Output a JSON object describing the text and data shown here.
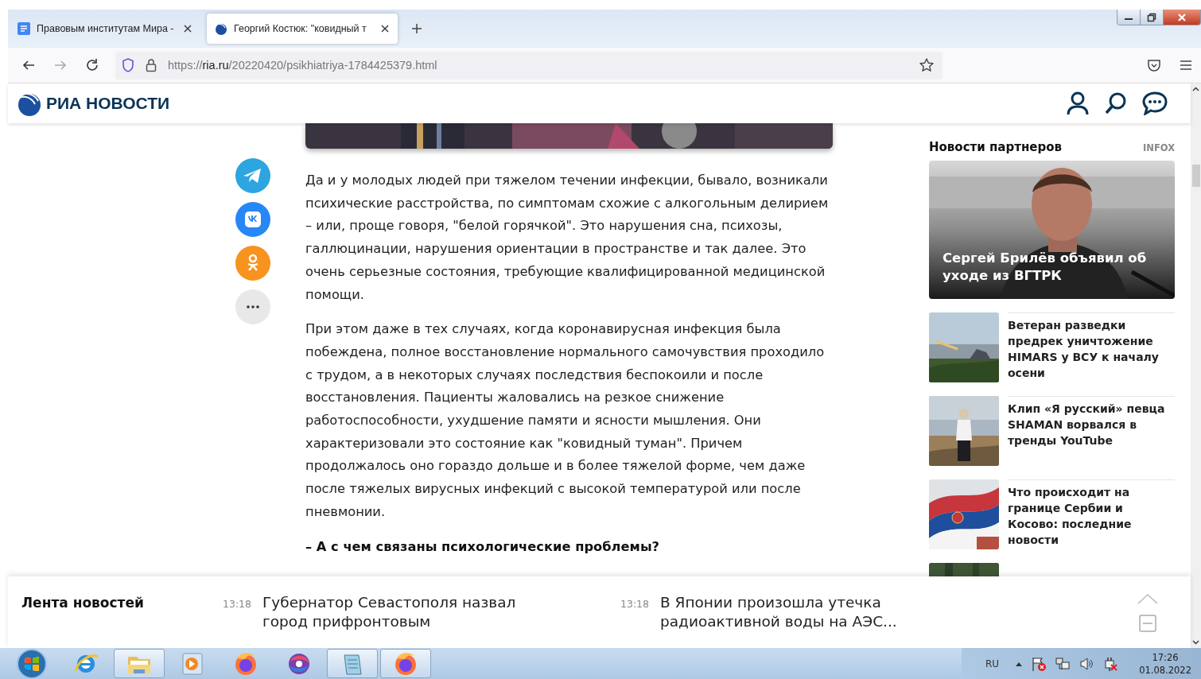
{
  "browser": {
    "tabs": [
      {
        "title": "Правовым институтам Мира -",
        "kind": "document",
        "selected": false
      },
      {
        "title": "Георгий Костюк: \"ковидный т",
        "kind": "ria",
        "selected": true
      }
    ],
    "url": {
      "scheme": "https://",
      "host": "ria.ru",
      "path": "/20220420/psikhiatriya-1784425379.html"
    }
  },
  "site": {
    "logo": "РИА НОВОСТИ"
  },
  "share_buttons": [
    {
      "kind": "telegram"
    },
    {
      "kind": "vk"
    },
    {
      "kind": "ok"
    },
    {
      "kind": "more"
    }
  ],
  "article": {
    "blocks": [
      {
        "kind": "paragraph",
        "text": "Да и у молодых людей при тяжелом течении инфекции, бывало, возникали психические расстройства, по симптомам схожие с алкогольным делирием – или, проще говоря, \"белой горячкой\". Это нарушения сна, психозы, галлюцинации, нарушения ориентации в пространстве и так далее. Это очень серьезные состояния, требующие квалифицированной медицинской помощи."
      },
      {
        "kind": "paragraph",
        "text": "При этом даже в тех случаях, когда коронавирусная инфекция была побеждена, полное восстановление нормального самочувствия проходило с трудом, а в некоторых случаях последствия беспокоили и после восстановления. Пациенты жаловались на резкое снижение работоспособности, ухудшение памяти и ясности мышления. Они характеризовали это состояние как \"ковидный туман\". Причем продолжалось оно гораздо дольше и в более тяжелой форме, чем даже после тяжелых вирусных инфекций с высокой температурой или после пневмонии."
      },
      {
        "kind": "question",
        "text": "– А с чем связаны психологические проблемы?"
      }
    ]
  },
  "partner_news": {
    "title": "Новости партнеров",
    "source": "INFOX",
    "featured": {
      "headline": "Сергей Брилёв объявил об уходе из ВГТРК"
    },
    "items": [
      {
        "headline": "Ветеран разведки предрек уничтожение HIMARS у ВСУ к началу осени"
      },
      {
        "headline": "Клип «Я русский» певца SHAMAN ворвался в тренды YouTube"
      },
      {
        "headline": "Что происходит на границе Сербии и Косово: последние новости"
      }
    ]
  },
  "news_feed": {
    "title": "Лента новостей",
    "items": [
      {
        "time": "13:18",
        "headline": "Губернатор Севастополя назвал город прифронтовым"
      },
      {
        "time": "13:18",
        "headline": "В Японии произошла утечка радиоактивной воды на АЭС..."
      }
    ]
  },
  "taskbar": {
    "apps": [
      {
        "kind": "ie",
        "active": false
      },
      {
        "kind": "folder",
        "active": true
      },
      {
        "kind": "player",
        "active": false
      },
      {
        "kind": "firefox",
        "active": false
      },
      {
        "kind": "swirl",
        "active": false
      },
      {
        "kind": "notepad",
        "active": true
      },
      {
        "kind": "firefox",
        "active": true
      }
    ],
    "language": "RU",
    "time": "17:26",
    "date": "01.08.2022"
  }
}
